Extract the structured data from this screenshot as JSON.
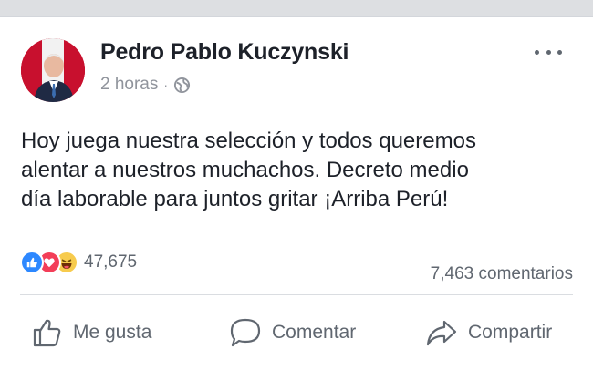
{
  "post": {
    "author": "Pedro Pablo Kuczynski",
    "time": "2 horas",
    "separator": "·",
    "privacy_icon": "globe-icon",
    "more_icon": "more-options-icon",
    "text_lines": [
      "Hoy juega nuestra selección y todos queremos",
      "alentar a nuestros muchachos. Decreto medio",
      "día laborable para juntos gritar ¡Arriba Perú!"
    ]
  },
  "reactions": {
    "icons": [
      "like-reaction-icon",
      "love-reaction-icon",
      "haha-reaction-icon"
    ],
    "count": "47,675",
    "comments": "7,463 comentarios"
  },
  "actions": {
    "like_label": "Me gusta",
    "comment_label": "Comentar",
    "share_label": "Compartir"
  },
  "colors": {
    "like_blue": "#2d88ff",
    "love_red": "#f33e58",
    "haha_yellow": "#f7cb4d",
    "text": "#1d2129",
    "secondary": "#606770"
  }
}
